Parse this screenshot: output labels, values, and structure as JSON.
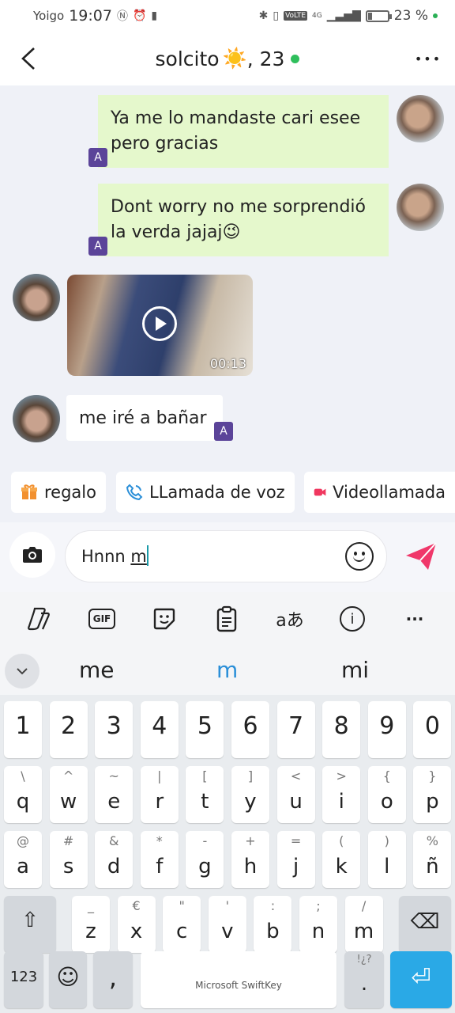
{
  "status_bar": {
    "carrier": "Yoigo",
    "time": "19:07",
    "battery": "23 %",
    "battery_level": 0.23,
    "network": "4G",
    "volte": "VoLTE"
  },
  "header": {
    "title": "solcito",
    "title_emoji": "☀️",
    "title_suffix": ", 23",
    "online": true,
    "back_icon": "chevron-left-icon",
    "more_icon": "more-horizontal-icon",
    "more_glyph": "•••"
  },
  "messages": [
    {
      "direction": "sent",
      "text": "Ya me lo mandaste cari esee pero gracias",
      "tag": "A"
    },
    {
      "direction": "sent",
      "text": "Dont worry no me sorprendió la verda jajaj😉",
      "tag": "A"
    },
    {
      "direction": "received",
      "type": "video",
      "duration": "00:13"
    },
    {
      "direction": "received",
      "text": "me iré a bañar",
      "tag": "A"
    }
  ],
  "quick_actions": [
    {
      "label": "regalo",
      "icon": "gift-icon"
    },
    {
      "label": "LLamada de voz",
      "icon": "phone-icon"
    },
    {
      "label": "Videollamada",
      "icon": "video-camera-icon"
    }
  ],
  "composer": {
    "text_before": "Hnnn ",
    "text_underlined": "m",
    "camera_icon": "camera-icon",
    "emoji_icon": "smiley-icon",
    "send_icon": "send-icon"
  },
  "keyboard": {
    "toolbar": [
      {
        "icon": "copilot-icon",
        "label": ""
      },
      {
        "icon": "gif-icon",
        "label": "GIF"
      },
      {
        "icon": "sticker-icon",
        "label": ""
      },
      {
        "icon": "clipboard-icon",
        "label": ""
      },
      {
        "icon": "translate-icon",
        "label": "aあ"
      },
      {
        "icon": "info-icon",
        "label": "i"
      },
      {
        "icon": "more-icon",
        "label": "···"
      }
    ],
    "suggestions": [
      "me",
      "m",
      "mi"
    ],
    "number_row": [
      "1",
      "2",
      "3",
      "4",
      "5",
      "6",
      "7",
      "8",
      "9",
      "0"
    ],
    "row1": [
      {
        "main": "q",
        "alt": "\\"
      },
      {
        "main": "w",
        "alt": "^"
      },
      {
        "main": "e",
        "alt": "~"
      },
      {
        "main": "r",
        "alt": "|"
      },
      {
        "main": "t",
        "alt": "["
      },
      {
        "main": "y",
        "alt": "]"
      },
      {
        "main": "u",
        "alt": "<"
      },
      {
        "main": "i",
        "alt": ">"
      },
      {
        "main": "o",
        "alt": "{"
      },
      {
        "main": "p",
        "alt": "}"
      }
    ],
    "row2": [
      {
        "main": "a",
        "alt": "@"
      },
      {
        "main": "s",
        "alt": "#"
      },
      {
        "main": "d",
        "alt": "&"
      },
      {
        "main": "f",
        "alt": "*"
      },
      {
        "main": "g",
        "alt": "-"
      },
      {
        "main": "h",
        "alt": "+"
      },
      {
        "main": "j",
        "alt": "="
      },
      {
        "main": "k",
        "alt": "("
      },
      {
        "main": "l",
        "alt": ")"
      },
      {
        "main": "ñ",
        "alt": "%"
      }
    ],
    "row3": [
      {
        "main": "z",
        "alt": "_"
      },
      {
        "main": "x",
        "alt": "€"
      },
      {
        "main": "c",
        "alt": "\""
      },
      {
        "main": "v",
        "alt": "'"
      },
      {
        "main": "b",
        "alt": ":"
      },
      {
        "main": "n",
        "alt": ";"
      },
      {
        "main": "m",
        "alt": "/"
      }
    ],
    "shift_glyph": "⇧",
    "backspace_glyph": "⌫",
    "numbers_label": "123",
    "emoji_glyph": "☺",
    "comma_label": ",",
    "space_label": "Microsoft SwiftKey",
    "period_label": ".",
    "period_alt": "!¿?",
    "enter_glyph": "⏎"
  }
}
